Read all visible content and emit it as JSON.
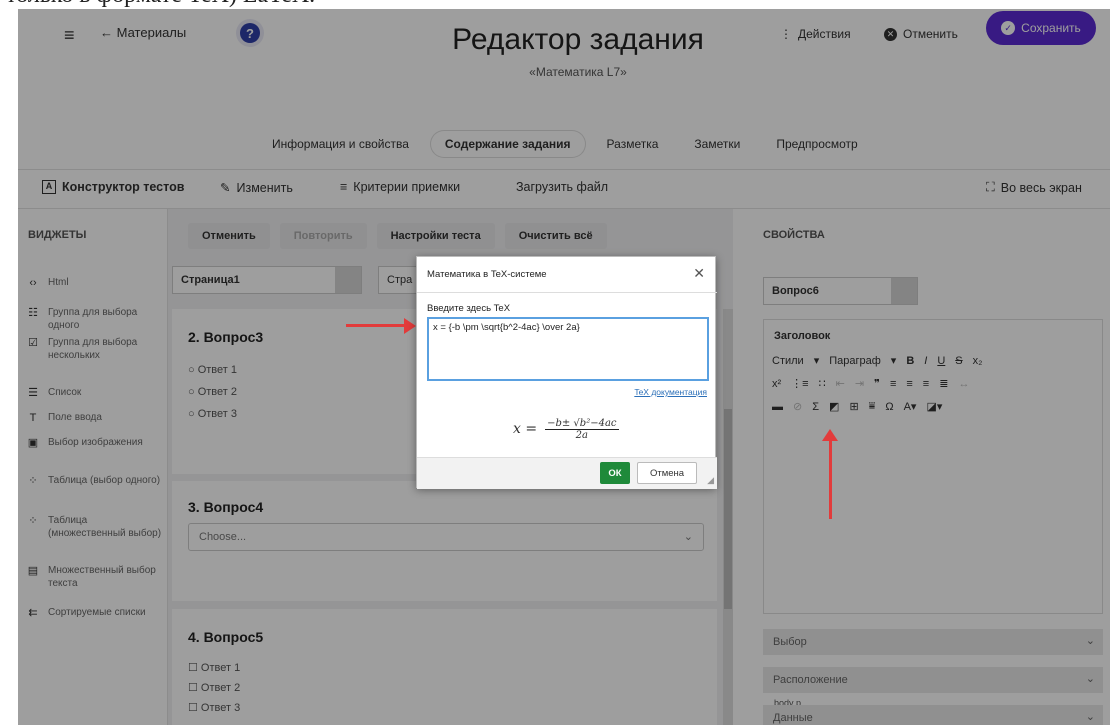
{
  "caption": "только в формате TeX) LaTeX.",
  "header": {
    "back_label": "Материалы",
    "title": "Редактор задания",
    "subtitle": "«Математика L7»",
    "actions_label": "Действия",
    "cancel_label": "Отменить",
    "save_label": "Сохранить",
    "accent_color": "#5b2bd4"
  },
  "tabs": [
    {
      "label": "Информация и свойства"
    },
    {
      "label": "Содержание задания"
    },
    {
      "label": "Разметка"
    },
    {
      "label": "Заметки"
    },
    {
      "label": "Предпросмотр"
    }
  ],
  "toolbar": {
    "constructor_label": "Конструктор тестов",
    "edit_label": "Изменить",
    "criteria_label": "Критерии приемки",
    "upload_label": "Загрузить файл",
    "fullscreen_label": "Во весь экран"
  },
  "widgets": {
    "title": "ВИДЖЕТЫ",
    "items": [
      {
        "icon": "html-icon",
        "label": "Html"
      },
      {
        "icon": "single-choice-icon",
        "label": "Группа для выбора одного"
      },
      {
        "icon": "multi-choice-icon",
        "label": "Группа для выбора нескольких"
      },
      {
        "icon": "list-icon",
        "label": "Список"
      },
      {
        "icon": "text-input-icon",
        "label": "Поле ввода"
      },
      {
        "icon": "image-choice-icon",
        "label": "Выбор изображения"
      },
      {
        "icon": "table-single-icon",
        "label": "Таблица (выбор одного)"
      },
      {
        "icon": "table-multi-icon",
        "label": "Таблица (множественный выбор)"
      },
      {
        "icon": "multi-text-icon",
        "label": "Множественный выбор текста"
      },
      {
        "icon": "sortable-icon",
        "label": "Сортируемые списки"
      }
    ]
  },
  "editor": {
    "undo_label": "Отменить",
    "redo_label": "Повторить",
    "settings_label": "Настройки теста",
    "clear_label": "Очистить всё",
    "page_select": "Страница1",
    "page_select2": "Стра",
    "q3": {
      "title": "2. Вопрос3",
      "options": [
        "Ответ 1",
        "Ответ 2",
        "Ответ 3"
      ]
    },
    "q4": {
      "title": "3. Вопрос4",
      "placeholder": "Choose..."
    },
    "q5": {
      "title": "4. Вопрос5",
      "options": [
        "Ответ 1",
        "Ответ 2",
        "Ответ 3"
      ]
    }
  },
  "properties": {
    "title": "СВОЙСТВА",
    "question_select": "Вопрос6",
    "heading_label": "Заголовок",
    "styles_label": "Стили",
    "paragraph_label": "Параграф",
    "path_label": "body  p",
    "accordions": [
      "Выбор",
      "Расположение",
      "Данные"
    ]
  },
  "dialog": {
    "title": "Математика в TeX-системе",
    "input_label": "Введите здесь TeX",
    "input_value": "x = {-b \\pm \\sqrt{b^2-4ac} \\over 2a}",
    "doc_link": "TeX документация",
    "preview_lhs": "x =",
    "preview_num": "−b± √b²−4ac",
    "preview_den": "2a",
    "ok_label": "ОК",
    "cancel_label": "Отмена",
    "ok_color": "#1f8a3a"
  }
}
